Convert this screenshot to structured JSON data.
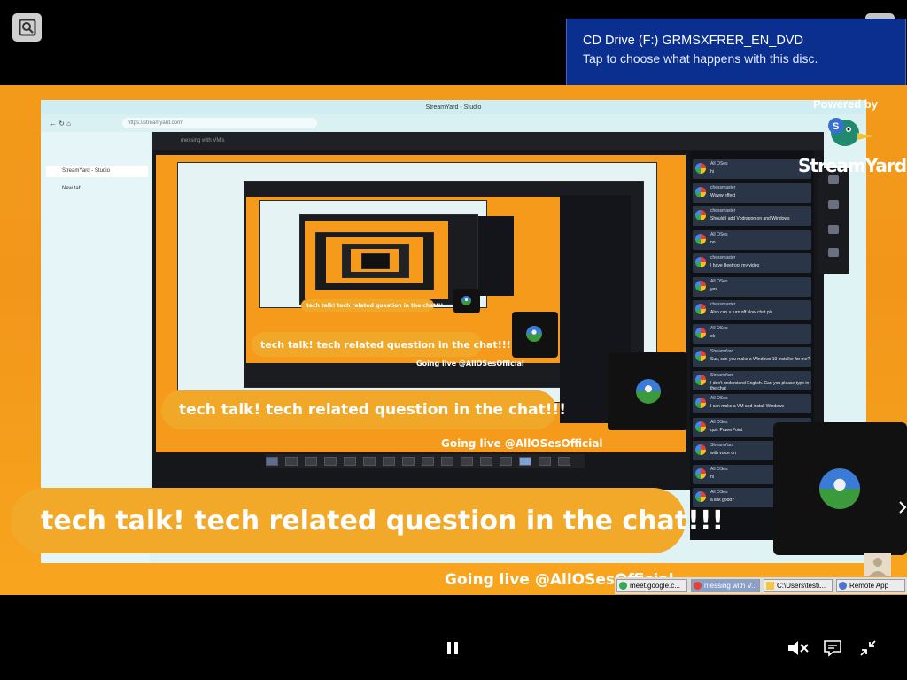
{
  "toast": {
    "title": "CD Drive (F:) GRMSXFRER_EN_DVD",
    "message": "Tap to choose what happens with this disc."
  },
  "video": {
    "banner_text": "tech talk! tech related question in the chat!!!",
    "live_text": "Going live @AllOSesOfficial",
    "powered_by": "Powered by",
    "brand": "StreamYard"
  },
  "browser": {
    "window_title": "StreamYard - Studio",
    "url": "https://streamyard.com/",
    "tab_label": "StreamYard - Studio",
    "new_tab": "New tab",
    "studio_title": "messing with VM's"
  },
  "chat": {
    "messages": [
      {
        "name": "All OSes",
        "text": "hi"
      },
      {
        "name": "chessmaster",
        "text": "Woww effect"
      },
      {
        "name": "chessmaster",
        "text": "Should I add Vpdragon on and Windows"
      },
      {
        "name": "All OSes",
        "text": "no"
      },
      {
        "name": "chessmaster",
        "text": "I have Beetroot my video"
      },
      {
        "name": "All OSes",
        "text": "yes"
      },
      {
        "name": "chessmaster",
        "text": "Also can u turn off slow chat pls"
      },
      {
        "name": "All OSes",
        "text": "ok"
      },
      {
        "name": "StreamYard",
        "text": "Sus, can you make a Windows 10 installer for me?"
      },
      {
        "name": "StreamYard",
        "text": "I don't understand English. Can you please type in the chat"
      },
      {
        "name": "All OSes",
        "text": "I can make a VM and install Windows"
      },
      {
        "name": "All OSes",
        "text": "quiz PowerPoint"
      },
      {
        "name": "StreamYard",
        "text": "with voice on"
      },
      {
        "name": "All OSes",
        "text": "hi"
      },
      {
        "name": "All OSes",
        "text": "a link good?"
      }
    ]
  },
  "taskbar": {
    "items": [
      {
        "label": "meet.google.c...",
        "color": "#34a853"
      },
      {
        "label": "messing with V...",
        "color": "#e34133"
      },
      {
        "label": "C:\\Users\\test\\...",
        "color": "#f5c542"
      },
      {
        "label": "Remote App",
        "color": "#4a73c9"
      }
    ]
  },
  "controls": {
    "pause_icon": "pause-icon",
    "mute_icon": "muted-speaker-icon",
    "captions_icon": "captions-icon",
    "exit_fullscreen_icon": "exit-fullscreen-icon",
    "zoom_icon": "zoom-icon"
  }
}
